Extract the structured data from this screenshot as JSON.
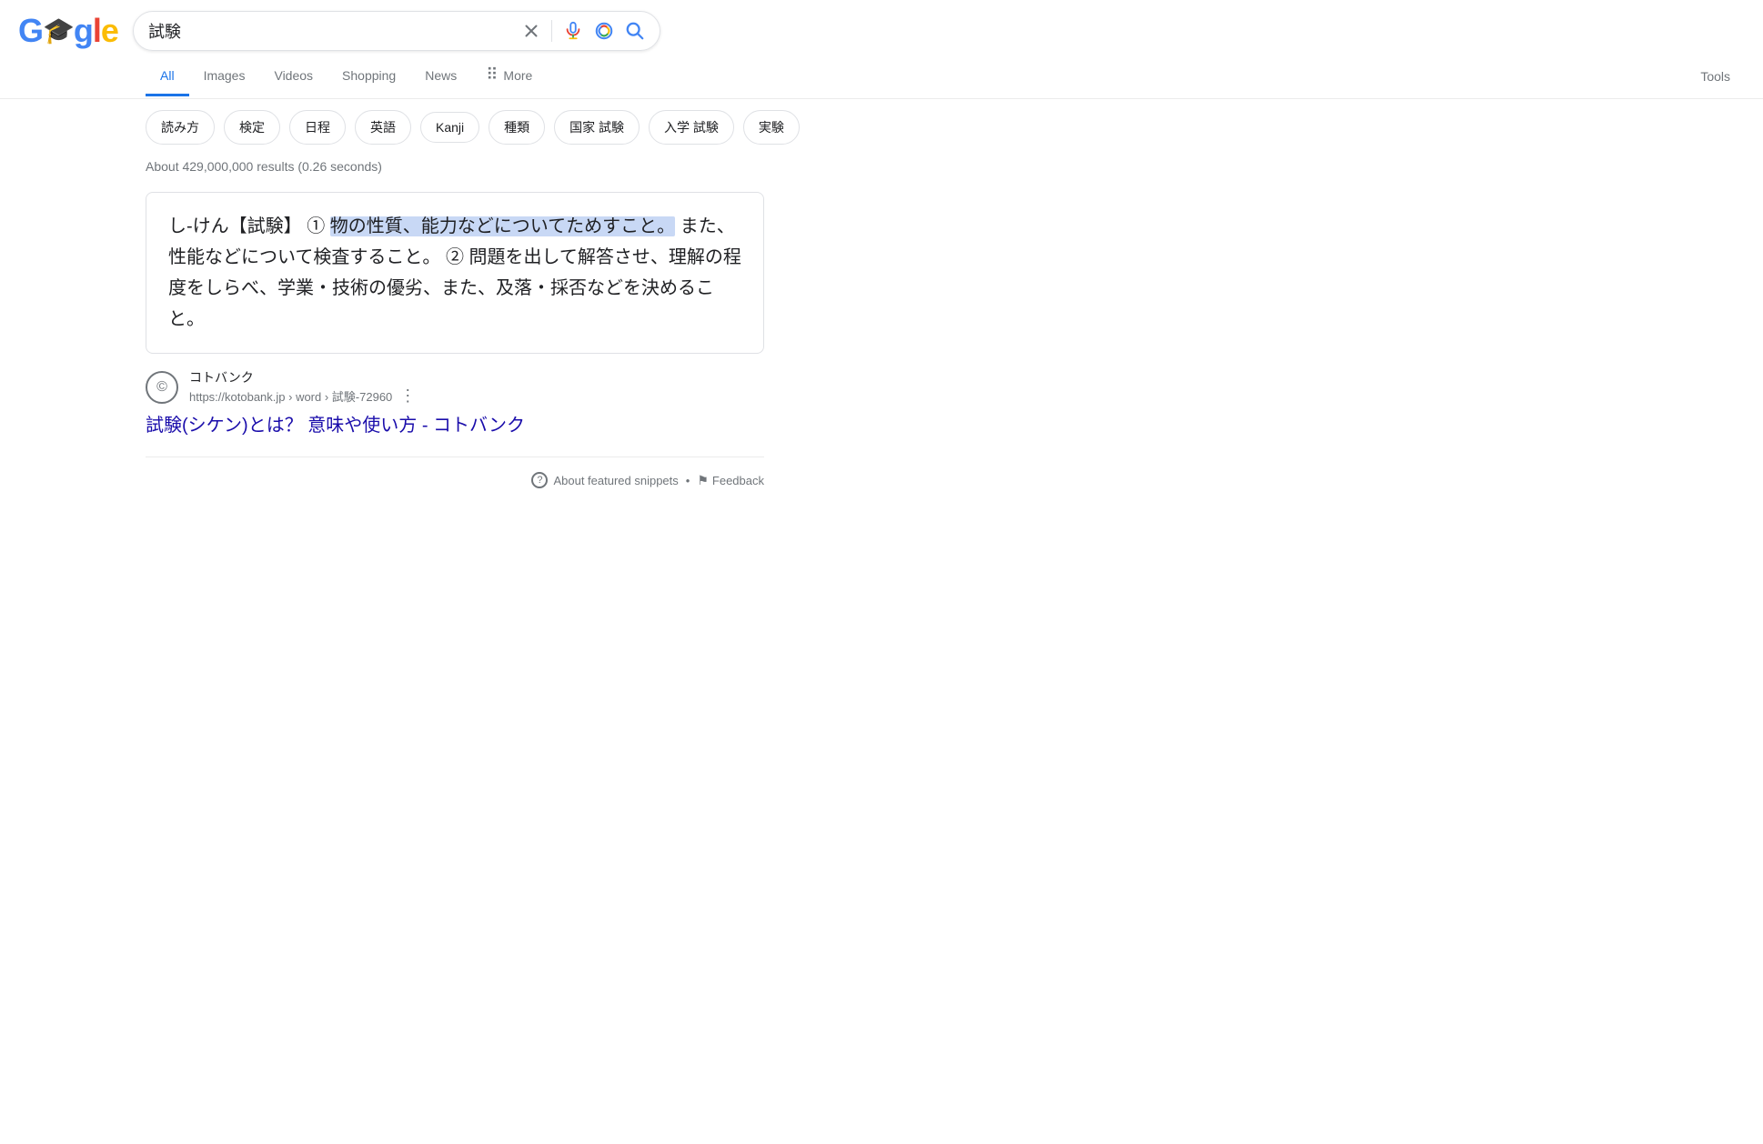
{
  "header": {
    "logo_text_g1": "G",
    "logo_owl": "🦉",
    "logo_text_ogle": "gle",
    "search_query": "試験",
    "search_placeholder": "試験"
  },
  "nav": {
    "tabs": [
      {
        "label": "All",
        "active": true
      },
      {
        "label": "Images",
        "active": false
      },
      {
        "label": "Videos",
        "active": false
      },
      {
        "label": "Shopping",
        "active": false
      },
      {
        "label": "News",
        "active": false
      },
      {
        "label": "More",
        "active": false,
        "has_dots": true
      }
    ],
    "tools_label": "Tools"
  },
  "chips": {
    "items": [
      {
        "label": "読み方"
      },
      {
        "label": "検定"
      },
      {
        "label": "日程"
      },
      {
        "label": "英語"
      },
      {
        "label": "Kanji"
      },
      {
        "label": "種類"
      },
      {
        "label": "国家 試験"
      },
      {
        "label": "入学 試験"
      },
      {
        "label": "実験"
      }
    ]
  },
  "results": {
    "count_text": "About 429,000,000 results (0.26 seconds)",
    "featured_snippet": {
      "text_before_highlight": "し‐けん【試験】 ① ",
      "text_highlighted": "物の性質、能力などについてためすこと。",
      "text_after": " また、性能などについて検査すること。 ② 問題を出して解答させ、理解の程度をしらべ、学業・技術の優劣、また、及落・採否などを決めること。"
    },
    "source": {
      "icon_char": "©",
      "name": "コトバンク",
      "url": "https://kotobank.jp › word › 試験-72960"
    },
    "result_title": "試験(シケン)とは？ 意味や使い方 - コトバンク"
  },
  "footer": {
    "about_snippets_label": "About featured snippets",
    "dot_separator": "•",
    "feedback_label": "Feedback"
  },
  "icons": {
    "close": "✕",
    "three_dots": "⋮",
    "help": "?",
    "feedback_char": "⚑"
  }
}
